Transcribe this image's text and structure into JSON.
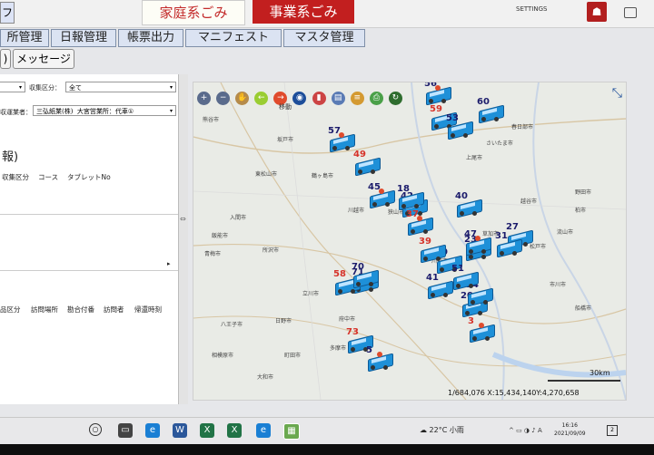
{
  "top": {
    "left_label": "フ",
    "tab_household": "家庭系ごみ",
    "tab_business": "事業系ごみ",
    "settings_label": "SETTINGS"
  },
  "menu": [
    "所管理",
    "日報管理",
    "帳票出力",
    "マニフェスト",
    "マスタ管理"
  ],
  "sub": [
    ")",
    "メッセージ"
  ],
  "filters": {
    "collection_type_label": "収集区分：",
    "collection_type_value": "全て",
    "contractor_label": "収運業者：",
    "contractor_value": "三弘紙業(株)",
    "office_label": "大宮営業所：代車①"
  },
  "section": {
    "title": "報)",
    "columns": [
      "収集区分",
      "コース",
      "タブレットNo"
    ],
    "bottom_columns": [
      "品区分",
      "訪問場所",
      "勘合付番",
      "訪問者",
      "帰還時刻"
    ]
  },
  "map": {
    "move_label": "移動",
    "scale": "30km",
    "coords": "1/684,076 X:15,434,140Y:4,270,658",
    "places": [
      "熊谷市",
      "東松山市",
      "坂戸市",
      "川越市",
      "鶴ヶ島市",
      "所沢市",
      "入間市",
      "青梅市",
      "飯能市",
      "八王子市",
      "相模原市",
      "町田市",
      "立川市",
      "大和市",
      "府中市",
      "さいたま市",
      "上尾市",
      "春日部市",
      "越谷市",
      "川口市",
      "草加市",
      "柏市",
      "松戸市",
      "市川市",
      "船橋市",
      "野田市",
      "流山市",
      "狭山市",
      "日野市",
      "多摩市"
    ],
    "vehicles": [
      "56",
      "59",
      "60",
      "57",
      "53",
      "49",
      "45",
      "42",
      "18",
      "37",
      "41",
      "40",
      "71",
      "58",
      "40",
      "23",
      "70",
      "73",
      "5",
      "20",
      "27",
      "3",
      "24",
      "31",
      "47",
      "39",
      "51"
    ]
  },
  "taskbar": {
    "weather": "22°C 小雨",
    "time": "16:16",
    "date": "2021/09/09",
    "ime": "A"
  },
  "colors": {
    "business_tab": "#c21f1f",
    "vehicle": "#1e90d8",
    "map_bg": "#e9ebe6"
  }
}
